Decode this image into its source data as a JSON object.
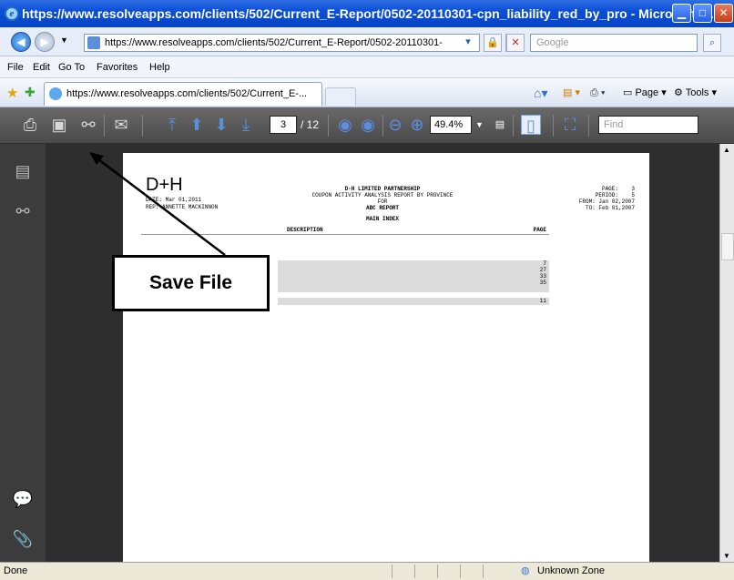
{
  "window": {
    "title": "https://www.resolveapps.com/clients/502/Current_E-Report/0502-20110301-cpn_liability_red_by_pro - Microsoft I..."
  },
  "address": {
    "url": "https://www.resolveapps.com/clients/502/Current_E-Report/0502-20110301-",
    "search_placeholder": "Google"
  },
  "menu": {
    "file": "File",
    "edit": "Edit",
    "goto": "Go To",
    "favorites": "Favorites",
    "help": "Help"
  },
  "tabs": {
    "active_label": "https://www.resolveapps.com/clients/502/Current_E-..."
  },
  "commands": {
    "page": "Page",
    "tools": "Tools"
  },
  "pdf_toolbar": {
    "current_page": "3",
    "total_pages": "/ 12",
    "zoom": "49.4%",
    "find_placeholder": "Find"
  },
  "report": {
    "logo": "D+H",
    "company": "D-H LIMITED PARTNERSHIP",
    "report_name": "COUPON ACTIVITY ANALYSIS REPORT BY PROVINCE",
    "for_label": "FOR",
    "client": "ABC REPORT",
    "date_line": "DATE: Mar 01,2011",
    "rep_line": "REP: ANNETTE MACKINNON",
    "page_line": "PAGE:    3",
    "period_line": "PERIOD:    5",
    "from_line": "FROM: Jan 02,2007",
    "to_line": "TO: Feb 01,2007",
    "index_title": "MAIN INDEX",
    "col_description": "DESCRIPTION",
    "col_page": "PAGE",
    "page_values": [
      "7",
      "27",
      "33",
      "35"
    ],
    "page_value_last": "11"
  },
  "annotation": {
    "label": "Save File"
  },
  "status": {
    "left": "Done",
    "zone": "Unknown Zone"
  }
}
